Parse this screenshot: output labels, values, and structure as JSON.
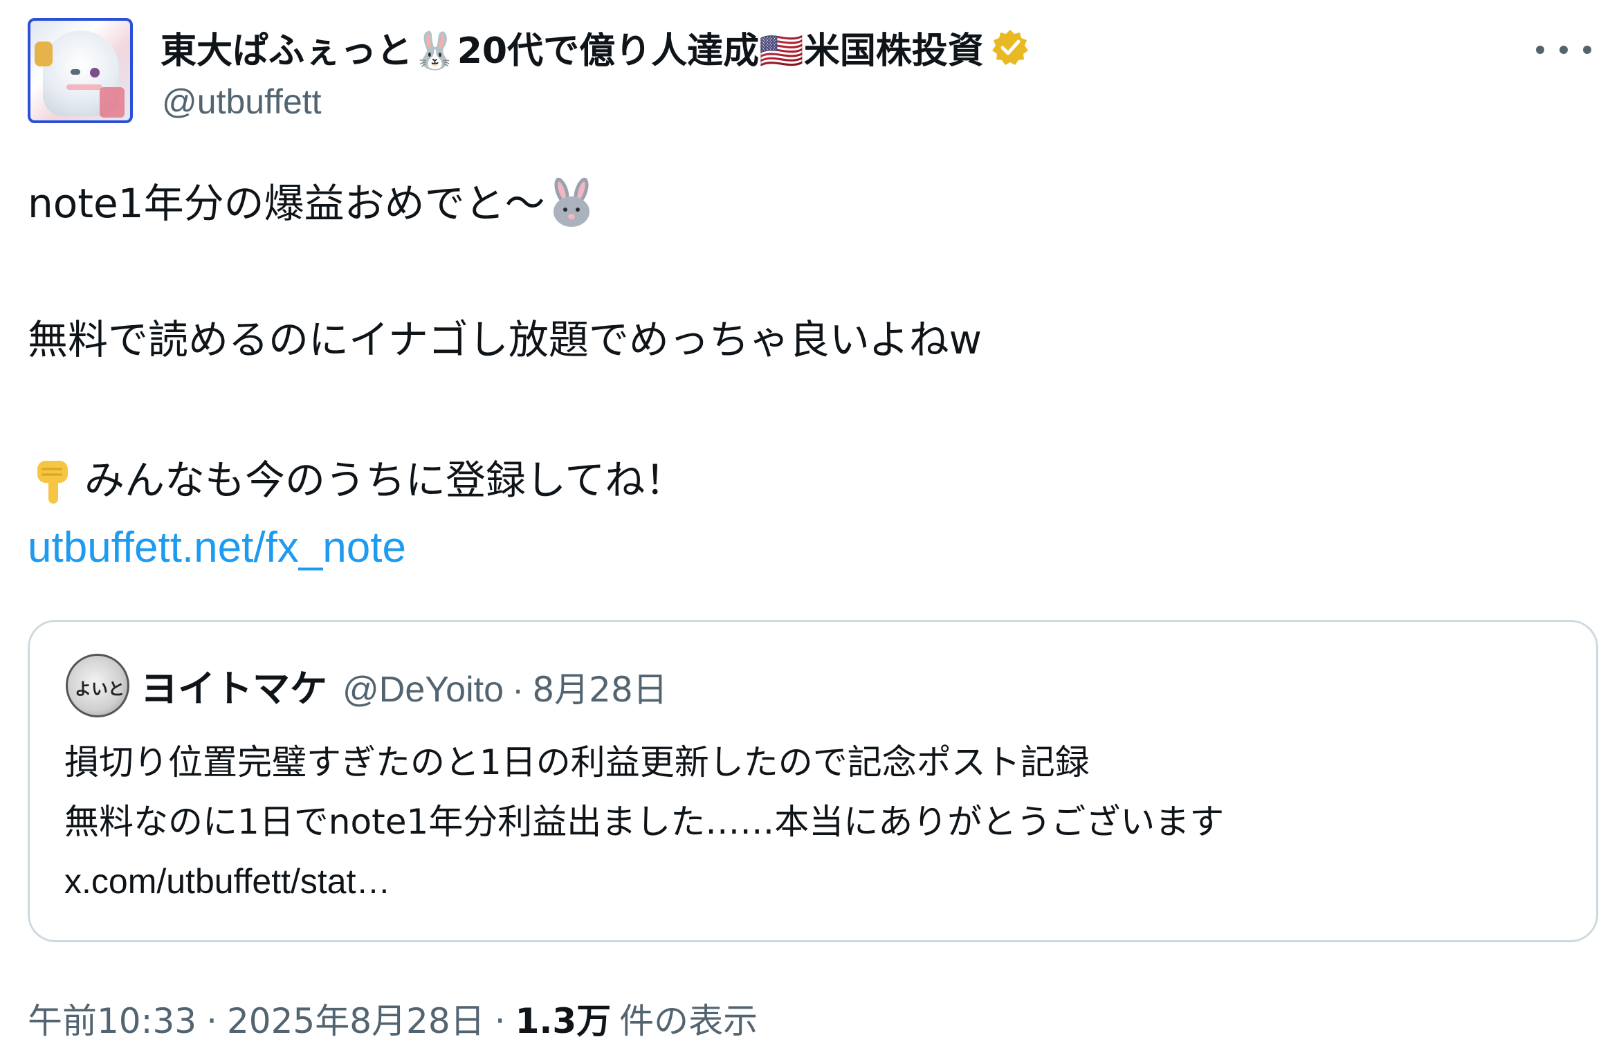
{
  "author": {
    "display_name": "東大ぱふぇっと🐰20代で億り人達成🇺🇸米国株投資",
    "handle": "@utbuffett",
    "verified_icon": "gold-verified-badge-icon",
    "more_icon": "more-options-icon"
  },
  "tweet": {
    "line1": "note1年分の爆益おめでと〜",
    "line1_emoji": "rabbit-face-icon",
    "line2": "無料で読めるのにイナゴし放題でめっちゃ良いよねw",
    "line3": "みんなも今のうちに登録してね！",
    "line3_emoji": "pointing-down-hand-icon",
    "link": "utbuffett.net/fx_note"
  },
  "quoted": {
    "avatar_text": "よいとまけ",
    "name": "ヨイトマケ",
    "handle": "@DeYoito",
    "separator": "·",
    "date": "8月28日",
    "line1": "損切り位置完璧すぎたのと1日の利益更新したので記念ポスト記録",
    "line2": "無料なのに1日でnote1年分利益出ました……本当にありがとうございます",
    "line3": "x.com/utbuffett/stat…"
  },
  "meta": {
    "time": "午前10:33",
    "separator": "·",
    "date": "2025年8月28日",
    "views_count": "1.3万",
    "views_label": "件の表示"
  },
  "colors": {
    "link": "#1d9bf0",
    "secondary_text": "#536471",
    "border": "#cfd9de",
    "verified": "#e8b923"
  }
}
